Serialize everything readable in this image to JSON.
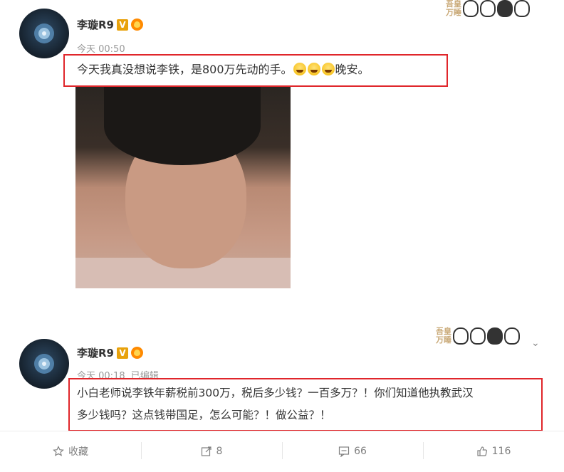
{
  "post1": {
    "username": "李璇R9",
    "v_badge": "V",
    "time": "今天 00:50",
    "text_before": "今天我真没想说李铁，是800万先动的手。",
    "text_after": "晚安。",
    "emoji_count": 3,
    "emoji_icon": "laughing-face-icon"
  },
  "post2": {
    "username": "李璇R9",
    "v_badge": "V",
    "time": "今天 00:18",
    "edited": "已编辑",
    "line1": "小白老师说李铁年薪税前300万，税后多少钱？一百多万？！你们知道他执教武汉",
    "line2": "多少钱吗？这点钱带国足，怎么可能？！做公益？！"
  },
  "sticker": {
    "line1": "吾皇",
    "line2": "万睡"
  },
  "actions": {
    "favorite": "收藏",
    "repost": "8",
    "comment": "66",
    "like": "116"
  },
  "colors": {
    "highlight_border": "#e0262b",
    "meta_text": "#999999",
    "badge": "#e8a20c"
  }
}
